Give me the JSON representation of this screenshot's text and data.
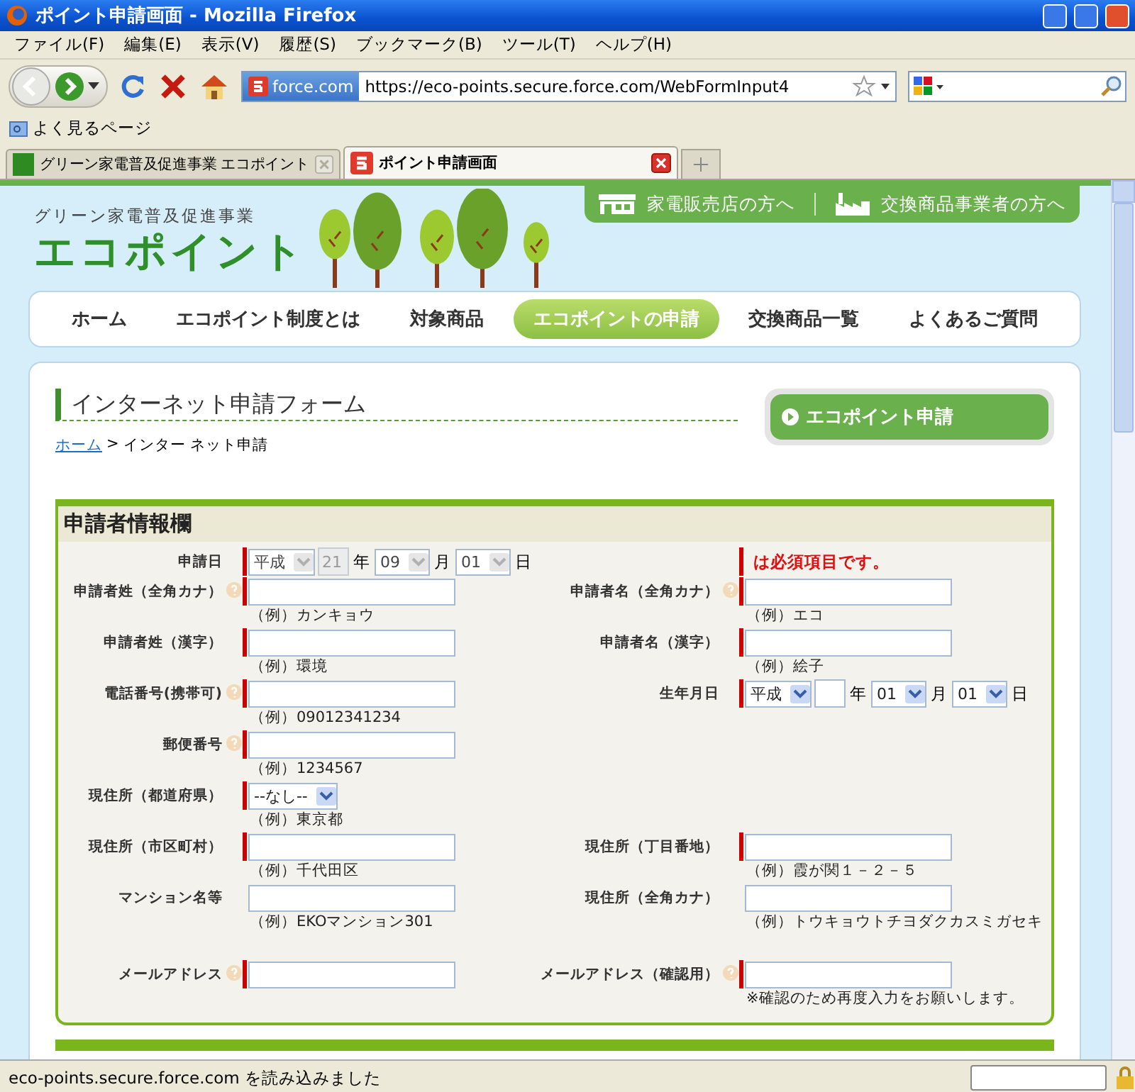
{
  "window": {
    "title": "ポイント申請画面 - Mozilla Firefox"
  },
  "menu": [
    "ファイル(F)",
    "編集(E)",
    "表示(V)",
    "履歴(S)",
    "ブックマーク(B)",
    "ツール(T)",
    "ヘルプ(H)"
  ],
  "address_bar": {
    "identity": "force.com",
    "url": "https://eco-points.secure.force.com/WebFormInput4"
  },
  "bookmarks": [
    "よく見るページ"
  ],
  "tabs": [
    {
      "label": "グリーン家電普及促進事業 エコポイント",
      "selected": false
    },
    {
      "label": "ポイント申請画面",
      "selected": true
    }
  ],
  "site": {
    "subtitle": "グリーン家電普及促進事業",
    "logo": "エコポイント",
    "top_links": [
      "家電販売店の方へ",
      "交換商品事業者の方へ"
    ]
  },
  "nav": [
    {
      "label": "ホーム",
      "selected": false
    },
    {
      "label": "エコポイント制度とは",
      "selected": false
    },
    {
      "label": "対象商品",
      "selected": false
    },
    {
      "label": "エコポイントの申請",
      "selected": true
    },
    {
      "label": "交換商品一覧",
      "selected": false
    },
    {
      "label": "よくあるご質問",
      "selected": false
    }
  ],
  "page": {
    "title": "インターネット申請フォーム",
    "breadcrumb": {
      "link": "ホーム",
      "separator": ">",
      "current": "インター ネット申請"
    },
    "side_button": "エコポイント申請"
  },
  "form": {
    "title": "申請者情報欄",
    "rows": [
      {
        "left": {
          "label": "申請日",
          "help": false,
          "required": true,
          "parts": [
            {
              "kind": "select",
              "value": "平成",
              "disabled": true
            },
            {
              "kind": "input",
              "value": "21",
              "disabled": true
            },
            {
              "kind": "unit",
              "text": "年"
            },
            {
              "kind": "select",
              "value": "09",
              "disabled": true
            },
            {
              "kind": "unit",
              "text": "月"
            },
            {
              "kind": "select",
              "value": "01",
              "disabled": true
            },
            {
              "kind": "unit",
              "text": "日"
            }
          ]
        },
        "right": {
          "legend": "は必須項目です。",
          "required": true
        }
      },
      {
        "left": {
          "label": "申請者姓（全角カナ）",
          "help": true,
          "required": true,
          "parts": [
            {
              "kind": "input"
            }
          ],
          "example": "（例）カンキョウ"
        },
        "right": {
          "label": "申請者名（全角カナ）",
          "help": true,
          "required": true,
          "parts": [
            {
              "kind": "input"
            }
          ],
          "example": "（例）エコ"
        }
      },
      {
        "left": {
          "label": "申請者姓（漢字）",
          "help": false,
          "required": true,
          "parts": [
            {
              "kind": "input"
            }
          ],
          "example": "（例）環境"
        },
        "right": {
          "label": "申請者名（漢字）",
          "help": false,
          "required": true,
          "parts": [
            {
              "kind": "input"
            }
          ],
          "example": "（例）絵子"
        }
      },
      {
        "left": {
          "label": "電話番号(携帯可)",
          "help": true,
          "required": true,
          "parts": [
            {
              "kind": "input"
            }
          ],
          "example": "（例）09012341234"
        },
        "right": {
          "label": "生年月日",
          "help": false,
          "required": true,
          "parts": [
            {
              "kind": "select",
              "value": "平成",
              "disabled": false
            },
            {
              "kind": "input",
              "disabled": false
            },
            {
              "kind": "unit",
              "text": "年"
            },
            {
              "kind": "select",
              "value": "01",
              "disabled": false
            },
            {
              "kind": "unit",
              "text": "月"
            },
            {
              "kind": "select",
              "value": "01",
              "disabled": false
            },
            {
              "kind": "unit",
              "text": "日"
            }
          ]
        }
      },
      {
        "left": {
          "label": "郵便番号",
          "help": true,
          "required": true,
          "parts": [
            {
              "kind": "input"
            }
          ],
          "example": "（例）1234567"
        }
      },
      {
        "left": {
          "label": "現住所（都道府県）",
          "help": false,
          "required": true,
          "parts": [
            {
              "kind": "select",
              "value": "--なし--",
              "disabled": false
            }
          ],
          "example": "（例）東京都"
        }
      },
      {
        "left": {
          "label": "現住所（市区町村）",
          "help": false,
          "required": true,
          "parts": [
            {
              "kind": "input"
            }
          ],
          "example": "（例）千代田区"
        },
        "right": {
          "label": "現住所（丁目番地）",
          "help": false,
          "required": true,
          "parts": [
            {
              "kind": "input"
            }
          ],
          "example": "（例）霞が関１－２－５"
        }
      },
      {
        "left": {
          "label": "マンション名等",
          "help": false,
          "required": false,
          "parts": [
            {
              "kind": "input"
            }
          ],
          "example": "（例）EKOマンション301"
        },
        "right": {
          "label": "現住所（全角カナ）",
          "help": false,
          "required": false,
          "parts": [
            {
              "kind": "input"
            }
          ],
          "example": "（例）トウキョウトチヨダクカスミガセキ"
        }
      },
      {
        "left": {
          "label": "メールアドレス",
          "help": true,
          "required": true,
          "parts": [
            {
              "kind": "input"
            }
          ]
        },
        "right": {
          "label": "メールアドレス（確認用）",
          "help": true,
          "required": true,
          "parts": [
            {
              "kind": "input"
            }
          ],
          "example": "※確認のため再度入力をお願いします。"
        }
      }
    ]
  },
  "status_bar": {
    "text": "eco-points.secure.force.com を読み込みました"
  }
}
